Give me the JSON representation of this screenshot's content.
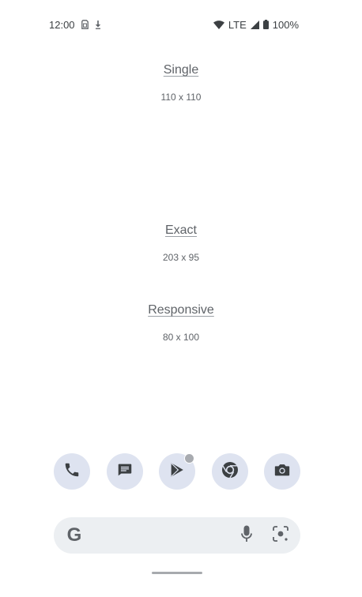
{
  "status_bar": {
    "time": "12:00",
    "network": "LTE",
    "battery": "100%",
    "icons": [
      "sim-card-icon",
      "download-icon",
      "wifi-icon",
      "cell-signal-icon",
      "battery-icon"
    ]
  },
  "widgets": [
    {
      "title": "Single",
      "size": "110 x 110"
    },
    {
      "title": "Exact",
      "size": "203 x 95"
    },
    {
      "title": "Responsive",
      "size": "80 x 100"
    }
  ],
  "dock": {
    "apps": [
      {
        "icon": "phone-icon"
      },
      {
        "icon": "messages-icon"
      },
      {
        "icon": "play-store-icon",
        "badge": true
      },
      {
        "icon": "chrome-icon"
      },
      {
        "icon": "camera-icon"
      }
    ]
  },
  "search": {
    "logo": "G",
    "icons": [
      "microphone-icon",
      "lens-icon"
    ]
  },
  "colors": {
    "text": "#5f6368",
    "dock_bg": "#dee3f0",
    "search_bg": "#eceff2",
    "icon": "#3c4043"
  }
}
